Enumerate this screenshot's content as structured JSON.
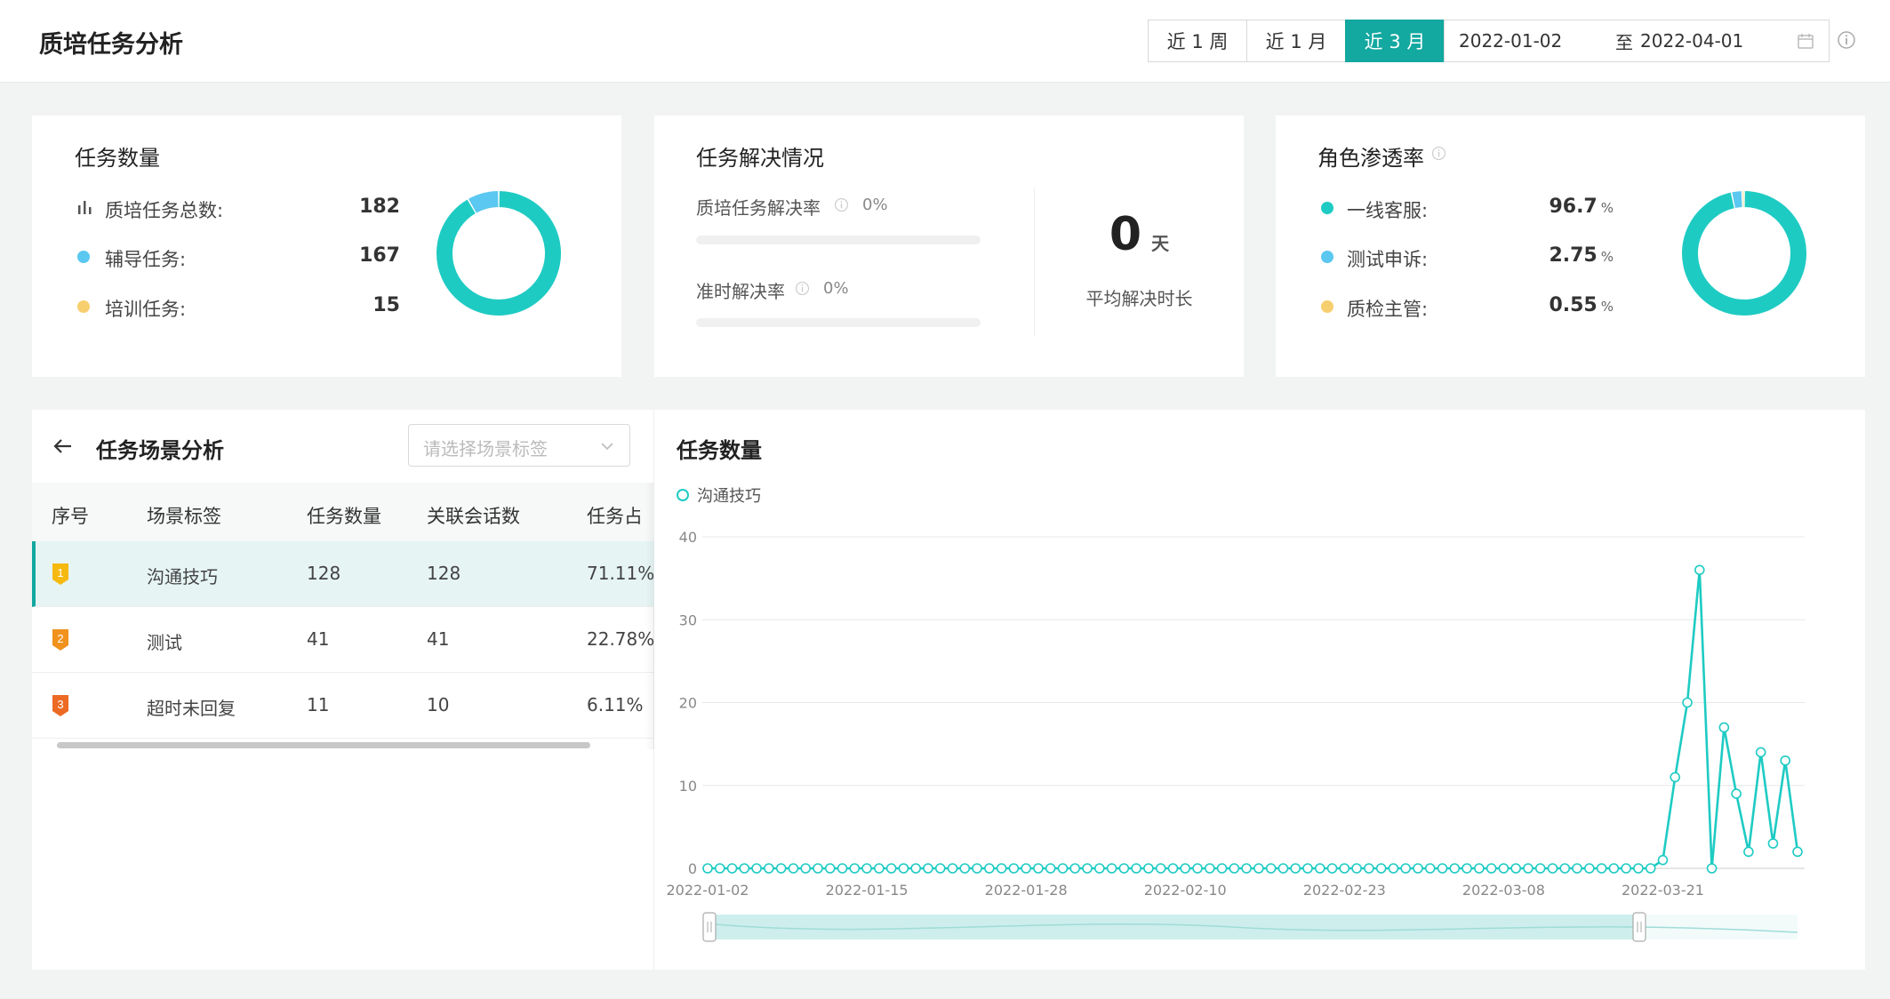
{
  "header": {
    "title": "质培任务分析",
    "ranges": [
      "近 1 周",
      "近 1 月",
      "近 3 月"
    ],
    "active_range": 2,
    "start_date": "2022-01-02",
    "to_label": "至",
    "end_date": "2022-04-01"
  },
  "task_count": {
    "title": "任务数量",
    "items": [
      {
        "label": "质培任务总数:",
        "value": "182",
        "icon": "bar-chart-icon"
      },
      {
        "label": "辅导任务:",
        "value": "167",
        "color": "#5ac8f0"
      },
      {
        "label": "培训任务:",
        "value": "15",
        "color": "#f7cf6e"
      }
    ],
    "donut": [
      {
        "name": "辅导任务",
        "value": 167,
        "color": "#1ecbc3"
      },
      {
        "name": "培训任务",
        "value": 15,
        "color": "#5ac8f0"
      }
    ]
  },
  "resolution": {
    "title": "任务解决情况",
    "rate_label": "质培任务解决率",
    "rate_value": "0%",
    "rate_fraction": 0,
    "ontime_label": "准时解决率",
    "ontime_value": "0%",
    "ontime_fraction": 0,
    "avg_value": "0",
    "avg_unit": "天",
    "avg_label": "平均解决时长"
  },
  "penetration": {
    "title": "角色渗透率",
    "unit": "%",
    "items": [
      {
        "label": "一线客服:",
        "value": "96.7",
        "color": "#1ecbc3"
      },
      {
        "label": "测试申诉:",
        "value": "2.75",
        "color": "#5ac8f0"
      },
      {
        "label": "质检主管:",
        "value": "0.55",
        "color": "#f7cf6e"
      }
    ],
    "donut": [
      {
        "name": "一线客服",
        "value": 96.7,
        "color": "#1ecbc3"
      },
      {
        "name": "测试申诉",
        "value": 2.75,
        "color": "#5ac8f0"
      },
      {
        "name": "质检主管",
        "value": 0.55,
        "color": "#f7cf6e"
      }
    ]
  },
  "scene": {
    "title": "任务场景分析",
    "select_placeholder": "请选择场景标签",
    "columns": [
      "序号",
      "场景标签",
      "任务数量",
      "关联会话数",
      "任务占比"
    ],
    "rows": [
      {
        "rank": "1",
        "tag": "沟通技巧",
        "count": "128",
        "sessions": "128",
        "ratio": "71.11%",
        "color": "#f5b90f"
      },
      {
        "rank": "2",
        "tag": "测试",
        "count": "41",
        "sessions": "41",
        "ratio": "22.78%",
        "color": "#f0921c"
      },
      {
        "rank": "3",
        "tag": "超时未回复",
        "count": "11",
        "sessions": "10",
        "ratio": "6.11%",
        "color": "#ec6a24"
      }
    ]
  },
  "chart_data": {
    "type": "line",
    "title": "任务数量",
    "series": [
      {
        "name": "沟通技巧",
        "color": "#1ecbc3",
        "values": [
          0,
          0,
          0,
          0,
          0,
          0,
          0,
          0,
          0,
          0,
          0,
          0,
          0,
          0,
          0,
          0,
          0,
          0,
          0,
          0,
          0,
          0,
          0,
          0,
          0,
          0,
          0,
          0,
          0,
          0,
          0,
          0,
          0,
          0,
          0,
          0,
          0,
          0,
          0,
          0,
          0,
          0,
          0,
          0,
          0,
          0,
          0,
          0,
          0,
          0,
          0,
          0,
          0,
          0,
          0,
          0,
          0,
          0,
          0,
          0,
          0,
          0,
          0,
          0,
          0,
          0,
          0,
          0,
          0,
          0,
          0,
          0,
          0,
          0,
          0,
          0,
          0,
          0,
          1,
          11,
          20,
          36,
          0,
          17,
          9,
          2,
          14,
          3,
          13,
          2
        ]
      }
    ],
    "x_start": "2022-01-02",
    "x_ticks": [
      "2022-01-02",
      "2022-01-15",
      "2022-01-28",
      "2022-02-10",
      "2022-02-23",
      "2022-03-08",
      "2022-03-21"
    ],
    "y_ticks": [
      0,
      10,
      20,
      30,
      40
    ],
    "ylim": [
      0,
      40
    ],
    "legend": "top-left",
    "grid": true
  }
}
